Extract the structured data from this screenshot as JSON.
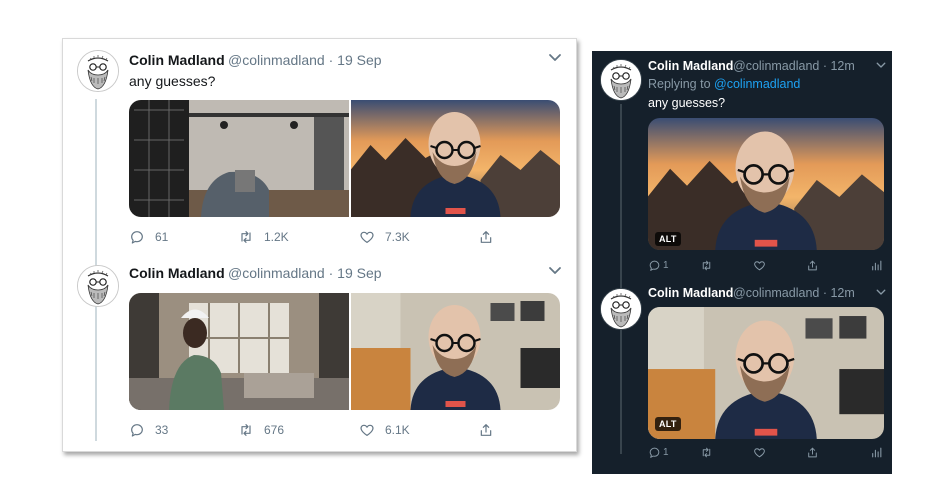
{
  "light": {
    "tweets": [
      {
        "name": "Colin Madland",
        "handle": "@colinmadland",
        "time": "19 Sep",
        "text": "any guesses?",
        "replies": "61",
        "retweets": "1.2K",
        "likes": "7.3K"
      },
      {
        "name": "Colin Madland",
        "handle": "@colinmadland",
        "time": "19 Sep",
        "replies": "33",
        "retweets": "676",
        "likes": "6.1K"
      }
    ]
  },
  "dark": {
    "tweets": [
      {
        "name": "Colin Madland",
        "handle": "@colinmadland",
        "time": "12m",
        "replying_prefix": "Replying to",
        "replying_to": "@colinmadland",
        "text": "any guesses?",
        "replies": "1",
        "alt": "ALT"
      },
      {
        "name": "Colin Madland",
        "handle": "@colinmadland",
        "time": "12m",
        "replies": "1",
        "alt": "ALT"
      }
    ]
  },
  "icons": [
    "reply-icon",
    "retweet-icon",
    "like-icon",
    "share-icon",
    "analytics-icon",
    "caret-down-icon"
  ],
  "colors": {
    "dark_bg": "#15202b",
    "link_blue": "#1da1f2",
    "light_secondary": "#657786",
    "dark_secondary": "#8899a6"
  }
}
